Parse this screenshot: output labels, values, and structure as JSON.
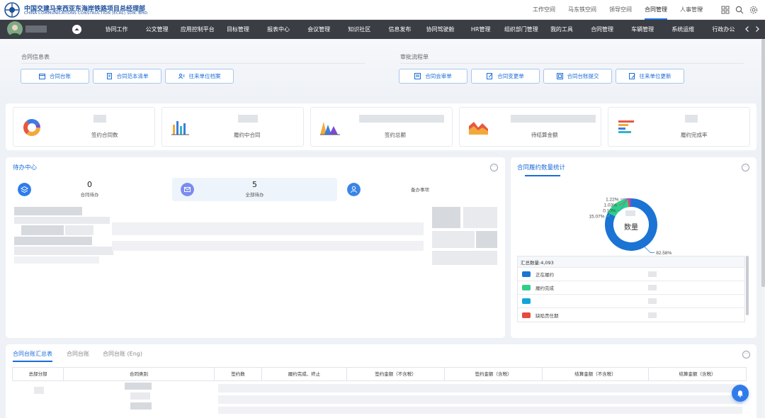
{
  "header": {
    "org_title": "中国交建马来西亚东海岸铁路项目总经理部",
    "org_subtitle": "CHINA COMMUNICATIONS CONSTRUCTION (ECRL) SDN. BHD.",
    "top_links": [
      {
        "label": "工作空间",
        "active": false
      },
      {
        "label": "马东铁空间",
        "active": false
      },
      {
        "label": "领导空间",
        "active": false
      },
      {
        "label": "合同管理",
        "active": true
      },
      {
        "label": "人事管理",
        "active": false
      }
    ],
    "icons": [
      "grid-icon",
      "search-icon",
      "settings-icon"
    ]
  },
  "nav": {
    "items": [
      "协同工作",
      "公文管理",
      "应用控制平台",
      "目标管理",
      "报表中心",
      "会议管理",
      "知识社区",
      "信息发布",
      "协同驾驶舱",
      "HR管理",
      "组织部门管理",
      "我的工具",
      "合同管理",
      "车辆管理",
      "系统运维",
      "行政办公"
    ]
  },
  "quick": {
    "left_label": "合同信息表",
    "right_label": "审批流程单",
    "left_buttons": [
      {
        "label": "合同台账",
        "icon": "calendar-icon"
      },
      {
        "label": "合同范本清单",
        "icon": "document-icon"
      },
      {
        "label": "往来单位档案",
        "icon": "user-list-icon"
      }
    ],
    "right_buttons": [
      {
        "label": "合同会审单",
        "icon": "form-icon"
      },
      {
        "label": "合同变更单",
        "icon": "edit-form-icon"
      },
      {
        "label": "合同台账提交",
        "icon": "submit-icon"
      },
      {
        "label": "往来单位更新",
        "icon": "update-icon"
      }
    ]
  },
  "stats": [
    {
      "label": "签约合同数",
      "icon": "donut-chart-icon"
    },
    {
      "label": "履约中合同",
      "icon": "bar-chart-icon"
    },
    {
      "label": "签约总额",
      "icon": "area-chart-icon"
    },
    {
      "label": "待结算金额",
      "icon": "mountain-chart-icon"
    },
    {
      "label": "履约完成率",
      "icon": "hbar-chart-icon"
    }
  ],
  "todo": {
    "title": "待办中心",
    "more": "···",
    "tabs": [
      {
        "count": "0",
        "label": "合同待办",
        "color": "#2f7bea"
      },
      {
        "count": "5",
        "label": "全部待办",
        "color": "#7b8cf0"
      },
      {
        "count": "",
        "label": "备办事项",
        "color": "#3a84e8"
      }
    ]
  },
  "contract_stats": {
    "title": "合同履约数量统计",
    "more": "···",
    "center_label": "数量",
    "total_label": "汇总数量:4,093",
    "legend": [
      {
        "name": "正在履约",
        "color": "#1b73d4"
      },
      {
        "name": "履约完成",
        "color": "#2fcf8a"
      },
      {
        "name": "",
        "color": "#15a4d9"
      },
      {
        "name": "缺陷责任期",
        "color": "#e64b3c"
      }
    ]
  },
  "chart_data": {
    "type": "pie",
    "title": "合同履约数量统计",
    "labels": [
      "",
      "",
      "",
      "",
      ""
    ],
    "values": [
      82.58,
      15.07,
      0.1,
      1.03,
      1.22
    ],
    "value_labels": [
      "82.58%",
      "15.07%",
      "0.10%",
      "1.03%",
      "1.22%"
    ],
    "colors": [
      "#1b73d4",
      "#2fcf8a",
      "#15a4d9",
      "#e64b3c",
      "#8a4bd6"
    ],
    "hole": true
  },
  "ledger": {
    "tabs": [
      {
        "label": "合同台账汇总表",
        "active": true
      },
      {
        "label": "合同台账",
        "active": false
      },
      {
        "label": "合同台账 (Eng)",
        "active": false
      }
    ],
    "more": "···",
    "columns": [
      "总部分部",
      "合同类别",
      "签约数",
      "履约完成、终止",
      "签约金额（不含税）",
      "签约金额（含税）",
      "结算金额（不含税）",
      "结算金额（含税）"
    ]
  }
}
